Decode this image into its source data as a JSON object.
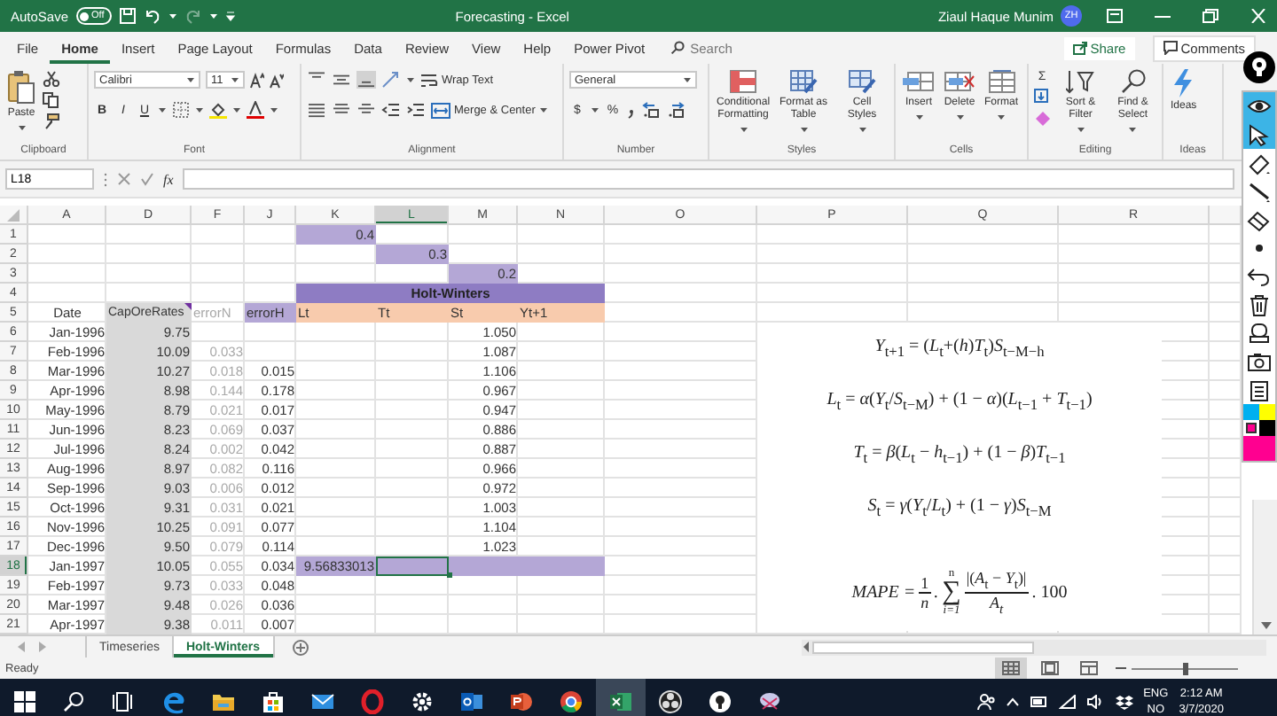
{
  "title_bar": {
    "autosave_label": "AutoSave",
    "autosave": {
      "label": "Off",
      "on": false
    },
    "title": "Forecasting - Excel",
    "user": "Ziaul Haque Munim",
    "initials": "ZH"
  },
  "ribbon_tabs": {
    "tabs": [
      {
        "label": "File",
        "selected": false
      },
      {
        "label": "Home",
        "selected": true
      },
      {
        "label": "Insert",
        "selected": false
      },
      {
        "label": "Page Layout",
        "selected": false
      },
      {
        "label": "Formulas",
        "selected": false
      },
      {
        "label": "Data",
        "selected": false
      },
      {
        "label": "Review",
        "selected": false
      },
      {
        "label": "View",
        "selected": false
      },
      {
        "label": "Help",
        "selected": false
      },
      {
        "label": "Power Pivot",
        "selected": false
      }
    ],
    "search": {
      "placeholder": "Search"
    },
    "share": "Share",
    "comments": "Comments"
  },
  "ribbon": {
    "groups": [
      {
        "kind": "clipboard",
        "label": "Clipboard",
        "paste": "Paste"
      },
      {
        "kind": "font",
        "label": "Font",
        "font": "Calibri",
        "size": "11",
        "bold": "B",
        "italic": "I",
        "underline": "U"
      },
      {
        "kind": "alignment",
        "label": "Alignment",
        "wrap": "Wrap Text",
        "merge": "Merge & Center",
        "vertical_align": [
          {
            "kind": "top",
            "selected": false
          },
          {
            "kind": "middle",
            "selected": false
          },
          {
            "kind": "bottom",
            "selected": true
          }
        ]
      },
      {
        "kind": "number",
        "label": "Number",
        "format": "General",
        "currency": "$",
        "percent": "%"
      },
      {
        "kind": "styles",
        "label": "Styles",
        "buttons": [
          "Conditional Formatting",
          "Format as Table",
          "Cell Styles"
        ]
      },
      {
        "kind": "cells",
        "label": "Cells",
        "buttons": [
          "Insert",
          "Delete",
          "Format"
        ]
      },
      {
        "kind": "editing",
        "label": "Editing",
        "sum": "Σ",
        "buttons": [
          "Sort & Filter",
          "Find & Select"
        ]
      },
      {
        "kind": "ideas",
        "label": "Ideas",
        "buttons": [
          "Ideas"
        ]
      }
    ]
  },
  "formula_bar": {
    "name_box": "L18",
    "fx": "fx"
  },
  "sheet": {
    "columns": [
      {
        "label": "A",
        "selected": false
      },
      {
        "label": "D",
        "selected": false
      },
      {
        "label": "F",
        "selected": false
      },
      {
        "label": "J",
        "selected": false
      },
      {
        "label": "K",
        "selected": false
      },
      {
        "label": "L",
        "selected": true
      },
      {
        "label": "M",
        "selected": false
      },
      {
        "label": "N",
        "selected": false
      },
      {
        "label": "O",
        "selected": false
      },
      {
        "label": "P",
        "selected": false
      },
      {
        "label": "Q",
        "selected": false
      },
      {
        "label": "R",
        "selected": false
      }
    ],
    "rows": [
      {
        "num": "1",
        "selected": false,
        "cells": {
          "K": {
            "text": "0.4",
            "kind": "purple"
          }
        }
      },
      {
        "num": "2",
        "selected": false,
        "cells": {
          "L": {
            "text": "0.3",
            "kind": "purple"
          }
        }
      },
      {
        "num": "3",
        "selected": false,
        "cells": {
          "M": {
            "text": "0.2",
            "kind": "purple"
          }
        }
      },
      {
        "num": "4",
        "selected": false,
        "cells": {
          "K": {
            "text": "Holt-Winters",
            "kind": "title"
          },
          "L": {
            "merged": true
          },
          "M": {
            "merged": true
          },
          "N": {
            "merged": true
          }
        }
      },
      {
        "num": "5",
        "selected": false,
        "cells": {
          "A": {
            "text": "Date",
            "kind": "label"
          },
          "D": {
            "text": "CapOreRates",
            "kind": "gray_head",
            "comment": true
          },
          "F": {
            "text": "errorN",
            "kind": "faint_head"
          },
          "J": {
            "text": "errorH",
            "kind": "purple_head"
          },
          "K": {
            "text": "Lt",
            "kind": "orange_head"
          },
          "L": {
            "text": "Tt",
            "kind": "orange_head"
          },
          "M": {
            "text": "St",
            "kind": "orange_head"
          },
          "N": {
            "text": "Yt+1",
            "kind": "orange_head"
          }
        }
      },
      {
        "num": "6",
        "selected": false,
        "cells": {
          "A": {
            "text": "Jan-1996"
          },
          "D": {
            "text": "9.75",
            "kind": "gray"
          },
          "M": {
            "text": "1.050"
          }
        }
      },
      {
        "num": "7",
        "selected": false,
        "cells": {
          "A": {
            "text": "Feb-1996"
          },
          "D": {
            "text": "10.09",
            "kind": "gray"
          },
          "F": {
            "text": "0.033",
            "kind": "faint"
          },
          "M": {
            "text": "1.087"
          }
        }
      },
      {
        "num": "8",
        "selected": false,
        "cells": {
          "A": {
            "text": "Mar-1996"
          },
          "D": {
            "text": "10.27",
            "kind": "gray"
          },
          "F": {
            "text": "0.018",
            "kind": "faint"
          },
          "J": {
            "text": "0.015"
          },
          "M": {
            "text": "1.106"
          }
        }
      },
      {
        "num": "9",
        "selected": false,
        "cells": {
          "A": {
            "text": "Apr-1996"
          },
          "D": {
            "text": "8.98",
            "kind": "gray"
          },
          "F": {
            "text": "0.144",
            "kind": "faint"
          },
          "J": {
            "text": "0.178"
          },
          "M": {
            "text": "0.967"
          }
        }
      },
      {
        "num": "10",
        "selected": false,
        "cells": {
          "A": {
            "text": "May-1996"
          },
          "D": {
            "text": "8.79",
            "kind": "gray"
          },
          "F": {
            "text": "0.021",
            "kind": "faint"
          },
          "J": {
            "text": "0.017"
          },
          "M": {
            "text": "0.947"
          }
        }
      },
      {
        "num": "11",
        "selected": false,
        "cells": {
          "A": {
            "text": "Jun-1996"
          },
          "D": {
            "text": "8.23",
            "kind": "gray"
          },
          "F": {
            "text": "0.069",
            "kind": "faint"
          },
          "J": {
            "text": "0.037"
          },
          "M": {
            "text": "0.886"
          }
        }
      },
      {
        "num": "12",
        "selected": false,
        "cells": {
          "A": {
            "text": "Jul-1996"
          },
          "D": {
            "text": "8.24",
            "kind": "gray"
          },
          "F": {
            "text": "0.002",
            "kind": "faint"
          },
          "J": {
            "text": "0.042"
          },
          "M": {
            "text": "0.887"
          }
        }
      },
      {
        "num": "13",
        "selected": false,
        "cells": {
          "A": {
            "text": "Aug-1996"
          },
          "D": {
            "text": "8.97",
            "kind": "gray"
          },
          "F": {
            "text": "0.082",
            "kind": "faint"
          },
          "J": {
            "text": "0.116"
          },
          "M": {
            "text": "0.966"
          }
        }
      },
      {
        "num": "14",
        "selected": false,
        "cells": {
          "A": {
            "text": "Sep-1996"
          },
          "D": {
            "text": "9.03",
            "kind": "gray"
          },
          "F": {
            "text": "0.006",
            "kind": "faint"
          },
          "J": {
            "text": "0.012"
          },
          "M": {
            "text": "0.972"
          }
        }
      },
      {
        "num": "15",
        "selected": false,
        "cells": {
          "A": {
            "text": "Oct-1996"
          },
          "D": {
            "text": "9.31",
            "kind": "gray"
          },
          "F": {
            "text": "0.031",
            "kind": "faint"
          },
          "J": {
            "text": "0.021"
          },
          "M": {
            "text": "1.003"
          }
        }
      },
      {
        "num": "16",
        "selected": false,
        "cells": {
          "A": {
            "text": "Nov-1996"
          },
          "D": {
            "text": "10.25",
            "kind": "gray"
          },
          "F": {
            "text": "0.091",
            "kind": "faint"
          },
          "J": {
            "text": "0.077"
          },
          "M": {
            "text": "1.104"
          }
        }
      },
      {
        "num": "17",
        "selected": false,
        "cells": {
          "A": {
            "text": "Dec-1996"
          },
          "D": {
            "text": "9.50",
            "kind": "gray"
          },
          "F": {
            "text": "0.079",
            "kind": "faint"
          },
          "J": {
            "text": "0.114"
          },
          "M": {
            "text": "1.023"
          }
        }
      },
      {
        "num": "18",
        "selected": true,
        "cells": {
          "A": {
            "text": "Jan-1997"
          },
          "D": {
            "text": "10.05",
            "kind": "gray"
          },
          "F": {
            "text": "0.055",
            "kind": "faint"
          },
          "J": {
            "text": "0.034"
          },
          "K": {
            "text": "9.56833013",
            "kind": "purple"
          },
          "L": {
            "kind": "purple",
            "selected": true
          },
          "M": {
            "kind": "purple"
          },
          "N": {
            "kind": "purple"
          }
        }
      },
      {
        "num": "19",
        "selected": false,
        "cells": {
          "A": {
            "text": "Feb-1997"
          },
          "D": {
            "text": "9.73",
            "kind": "gray"
          },
          "F": {
            "text": "0.033",
            "kind": "faint"
          },
          "J": {
            "text": "0.048"
          }
        }
      },
      {
        "num": "20",
        "selected": false,
        "cells": {
          "A": {
            "text": "Mar-1997"
          },
          "D": {
            "text": "9.48",
            "kind": "gray"
          },
          "F": {
            "text": "0.026",
            "kind": "faint"
          },
          "J": {
            "text": "0.036"
          }
        }
      },
      {
        "num": "21",
        "selected": false,
        "cells": {
          "A": {
            "text": "Apr-1997"
          },
          "D": {
            "text": "9.38",
            "kind": "gray"
          },
          "F": {
            "text": "0.011",
            "kind": "faint"
          },
          "J": {
            "text": "0.007"
          }
        }
      }
    ],
    "equations": [
      {
        "kind": "line",
        "text": "*Y*$_{t+1}$ = (*L*$_{t}$+(*h*)*T*$_{t}$)*S*$_{t−M−h}$"
      },
      {
        "kind": "line",
        "text": "*L*$_{t}$ = *α*(*Y*$_{t}$/*S*$_{t−M}$) + (1 − *α*)(*L*$_{t−1}$ + *T*$_{t−1}$)"
      },
      {
        "kind": "line",
        "text": "*T*$_{t}$ = *β*(*L*$_{t}$ − *h*$_{t−1}$) + (1 − *β*)*T*$_{t−1}$"
      },
      {
        "kind": "line",
        "text": "*S*$_{t}$ = *γ*(*Y*$_{t}$/*L*$_{t}$) + (1 − *γ*)*S*$_{t−M}$"
      },
      {
        "kind": "mape",
        "lhs": "MAPE =",
        "num": "1",
        "den": "n",
        "sep": ".",
        "sum": "∑",
        "upper": "n",
        "lower": "*i*=1",
        "frac_num": "|(*A*$_{t}$ − *Y*$_{t}$)|",
        "frac_den": "*A*$_{t}$",
        "tail": ". 100"
      }
    ]
  },
  "sheet_tabs": {
    "tabs": [
      {
        "label": "Timeseries",
        "selected": false
      },
      {
        "label": "Holt-Winters",
        "selected": true
      }
    ]
  },
  "status_bar": {
    "status": "Ready",
    "views": [
      {
        "kind": "normal",
        "selected": true
      },
      {
        "kind": "page-layout",
        "selected": false
      },
      {
        "kind": "page-break",
        "selected": false
      }
    ],
    "zoom": {
      "level": 0.5
    }
  },
  "taskbar": {
    "apps": [
      {
        "kind": "start",
        "selected": false
      },
      {
        "kind": "search",
        "selected": false
      },
      {
        "kind": "task-view",
        "selected": false
      },
      {
        "kind": "edge",
        "selected": false
      },
      {
        "kind": "explorer",
        "selected": false
      },
      {
        "kind": "store",
        "selected": false
      },
      {
        "kind": "mail",
        "selected": false
      },
      {
        "kind": "opera",
        "selected": false
      },
      {
        "kind": "settings",
        "selected": false
      },
      {
        "kind": "outlook",
        "selected": false
      },
      {
        "kind": "powerpoint",
        "selected": false
      },
      {
        "kind": "chrome",
        "selected": false
      },
      {
        "kind": "excel",
        "selected": true
      },
      {
        "kind": "obs",
        "selected": false
      },
      {
        "kind": "bulb",
        "selected": false
      },
      {
        "kind": "snip",
        "selected": false
      }
    ],
    "language": "ENG",
    "layout": "NO",
    "time": "2:12 AM",
    "date": "3/7/2020"
  },
  "annotation_toolbar": {
    "tools": [
      {
        "kind": "eye",
        "selected": true
      },
      {
        "kind": "cursor",
        "selected": true
      },
      {
        "kind": "highlighter",
        "selected": false
      },
      {
        "kind": "line",
        "selected": false
      },
      {
        "kind": "eraser",
        "selected": false
      },
      {
        "kind": "dot",
        "selected": false
      },
      {
        "kind": "undo",
        "selected": false
      },
      {
        "kind": "trash",
        "selected": false
      },
      {
        "kind": "stamp",
        "selected": false
      },
      {
        "kind": "camera",
        "selected": false
      },
      {
        "kind": "clipboard",
        "selected": false
      }
    ],
    "swatches": [
      {
        "color": "#00b0f0",
        "selected": false
      },
      {
        "color": "#ffff00",
        "selected": false
      },
      {
        "color": "#ff0090",
        "selected": true
      },
      {
        "color": "#000000",
        "selected": false
      }
    ]
  }
}
